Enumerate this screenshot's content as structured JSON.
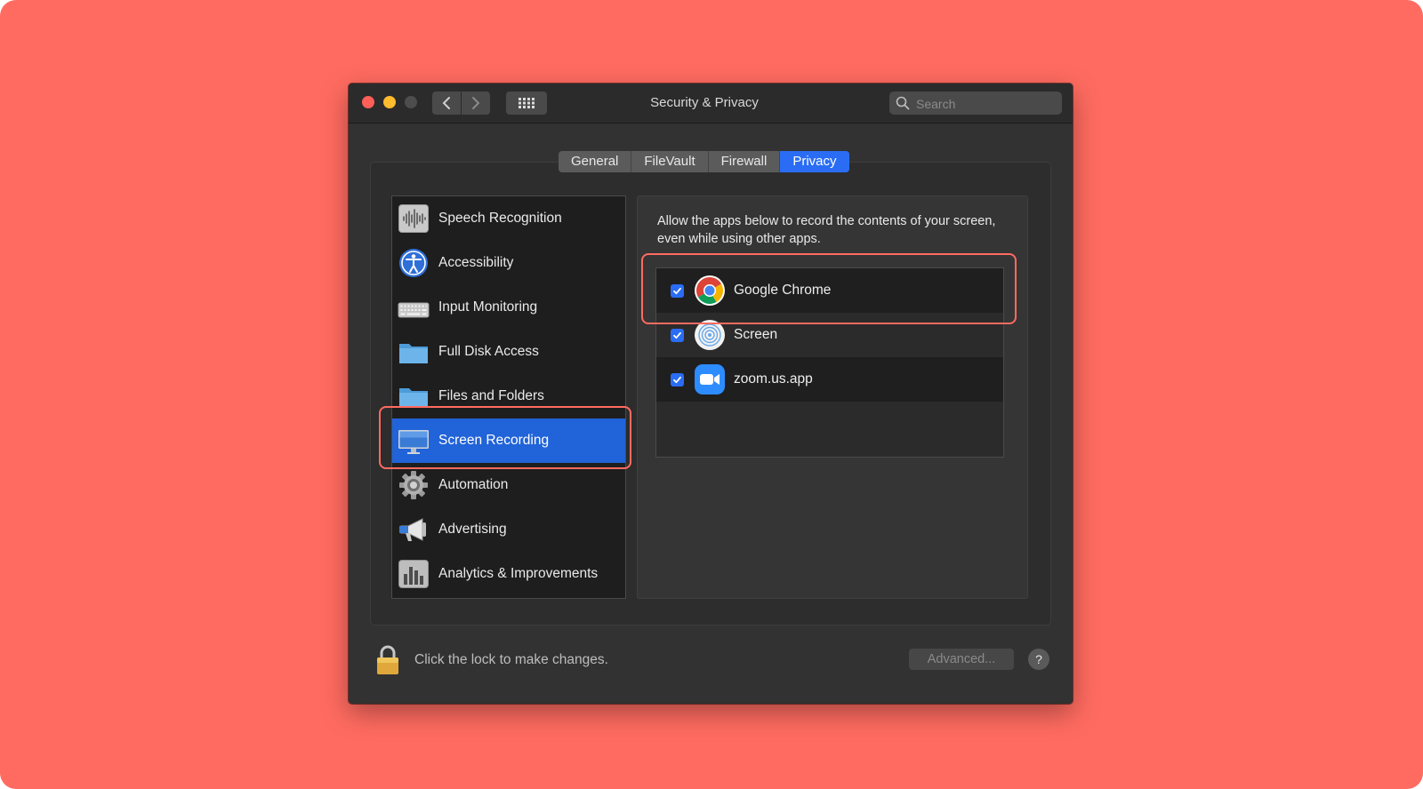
{
  "window": {
    "title": "Security & Privacy",
    "search_placeholder": "Search"
  },
  "tabs": [
    {
      "label": "General",
      "active": false
    },
    {
      "label": "FileVault",
      "active": false
    },
    {
      "label": "Firewall",
      "active": false
    },
    {
      "label": "Privacy",
      "active": true
    }
  ],
  "sidebar": {
    "items": [
      {
        "label": "Speech Recognition",
        "icon": "waveform-icon"
      },
      {
        "label": "Accessibility",
        "icon": "accessibility-icon"
      },
      {
        "label": "Input Monitoring",
        "icon": "keyboard-icon"
      },
      {
        "label": "Full Disk Access",
        "icon": "folder-icon"
      },
      {
        "label": "Files and Folders",
        "icon": "folder-icon"
      },
      {
        "label": "Screen Recording",
        "icon": "monitor-icon",
        "selected": true
      },
      {
        "label": "Automation",
        "icon": "gear-icon"
      },
      {
        "label": "Advertising",
        "icon": "megaphone-icon"
      },
      {
        "label": "Analytics & Improvements",
        "icon": "bar-chart-icon"
      }
    ]
  },
  "panel": {
    "description": "Allow the apps below to record the contents of your screen, even while using other apps.",
    "apps": [
      {
        "label": "Google Chrome",
        "checked": true,
        "icon": "chrome-icon"
      },
      {
        "label": "Screen",
        "checked": true,
        "icon": "screen-app-icon"
      },
      {
        "label": "zoom.us.app",
        "checked": true,
        "icon": "zoom-icon"
      }
    ]
  },
  "footer": {
    "lock_text": "Click the lock to make changes.",
    "advanced_label": "Advanced...",
    "help_label": "?"
  },
  "colors": {
    "backdrop": "#ff6b60",
    "accent": "#2a6df4",
    "selected_row": "#2163d8",
    "highlight": "#ff6b60"
  }
}
